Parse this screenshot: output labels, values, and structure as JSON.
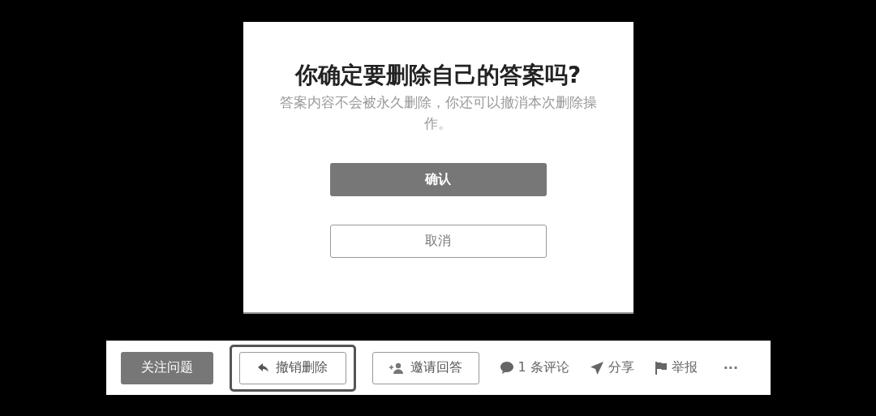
{
  "dialog": {
    "title": "你确定要删除自己的答案吗?",
    "message": "答案内容不会被永久删除，你还可以撤消本次删除操作。",
    "buttons": [
      {
        "label": "确认",
        "kind": "primary"
      },
      {
        "label": "取消",
        "kind": "outline"
      }
    ]
  },
  "action_bar": [
    {
      "kind": "primary",
      "label": "关注问题",
      "highlighted": false
    },
    {
      "kind": "outline",
      "label": "撤销删除",
      "highlighted": true
    },
    {
      "kind": "outline",
      "label": "邀请回答",
      "highlighted": false
    },
    {
      "kind": "link",
      "label": "1 条评论",
      "highlighted": false
    },
    {
      "kind": "link",
      "label": "分享",
      "highlighted": false
    },
    {
      "kind": "link",
      "label": "举报",
      "highlighted": false
    },
    {
      "kind": "more",
      "label": "···",
      "highlighted": false
    }
  ]
}
